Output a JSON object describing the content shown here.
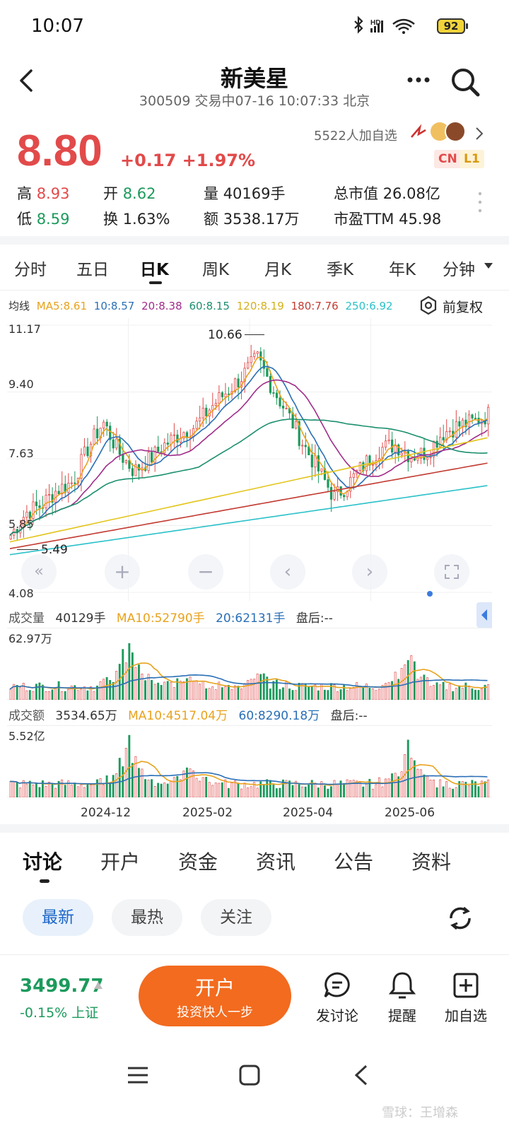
{
  "status": {
    "time": "10:07",
    "battery": "92",
    "network": "HD"
  },
  "header": {
    "title": "新美星",
    "subtitle": "300509 交易中07-16 10:07:33 北京"
  },
  "quote": {
    "price": "8.80",
    "change": "+0.17 +1.97%",
    "followers": "5522人加自选",
    "badges": [
      "CN",
      "L1"
    ],
    "stats": {
      "high_label": "高",
      "high": "8.93",
      "open_label": "开",
      "open": "8.62",
      "volume_label": "量",
      "volume": "40169手",
      "mcap_label": "总市值",
      "mcap": "26.08亿",
      "low_label": "低",
      "low": "8.59",
      "turnover_label": "换",
      "turnover": "1.63%",
      "amount_label": "额",
      "amount": "3538.17万",
      "pe_label": "市盈TTM",
      "pe": "45.98"
    }
  },
  "chart_tabs": [
    "分时",
    "五日",
    "日K",
    "周K",
    "月K",
    "季K",
    "年K",
    "分钟"
  ],
  "chart_tabs_active": "日K",
  "ma_legend": {
    "label": "均线",
    "items": [
      {
        "text": "MA5:8.61",
        "color": "#e8a21d"
      },
      {
        "text": "10:8.57",
        "color": "#2a6fb6"
      },
      {
        "text": "20:8.38",
        "color": "#a02c8a"
      },
      {
        "text": "60:8.15",
        "color": "#1b8f6e"
      },
      {
        "text": "120:8.19",
        "color": "#e3c51b"
      },
      {
        "text": "180:7.76",
        "color": "#c23b32"
      },
      {
        "text": "250:6.92",
        "color": "#2bc1c9"
      }
    ],
    "adjust": "前复权"
  },
  "price_axis": {
    "max": "11.17",
    "l2": "9.40",
    "l3": "7.63",
    "l4": "5.85",
    "min": "4.08"
  },
  "annotations": {
    "high": "10.66",
    "low": "5.49"
  },
  "volume_panel": {
    "label": "成交量",
    "value": "40129手",
    "ma10": "MA10:52790手",
    "ma20": "20:62131手",
    "after": "盘后:--",
    "max": "62.97万"
  },
  "amount_panel": {
    "label": "成交额",
    "value": "3534.65万",
    "ma10": "MA10:4517.04万",
    "ma60": "60:8290.18万",
    "after": "盘后:--",
    "max": "5.52亿"
  },
  "x_axis": [
    "2024-12",
    "2025-02",
    "2025-04",
    "2025-06"
  ],
  "discussion_tabs": [
    "讨论",
    "开户",
    "资金",
    "资讯",
    "公告",
    "资料"
  ],
  "filters": [
    "最新",
    "最热",
    "关注"
  ],
  "bottom_bar": {
    "index_value": "3499.77",
    "index_change": "-0.15% 上证",
    "open_title": "开户",
    "open_sub": "投资快人一步",
    "actions": [
      "发讨论",
      "提醒",
      "加自选"
    ]
  },
  "watermark": "雪球：王增森",
  "chart_data": {
    "type": "candlestick",
    "y_range": [
      4.08,
      11.17
    ],
    "x_ticks": [
      "2024-12",
      "2025-02",
      "2025-04",
      "2025-06"
    ],
    "approx_close_path": [
      5.6,
      6.2,
      6.4,
      6.8,
      7.0,
      7.9,
      8.6,
      7.8,
      7.3,
      7.6,
      8.0,
      8.3,
      8.5,
      9.0,
      9.4,
      9.8,
      10.3,
      9.5,
      8.8,
      8.0,
      7.3,
      6.6,
      7.0,
      7.5,
      7.9,
      8.0,
      7.7,
      7.8,
      8.3,
      8.5,
      8.6,
      8.8
    ],
    "ma_colors": [
      "#e8a21d",
      "#2a6fb6",
      "#a02c8a",
      "#1b8f6e",
      "#e3c51b",
      "#c23b32",
      "#2bc1c9"
    ]
  }
}
